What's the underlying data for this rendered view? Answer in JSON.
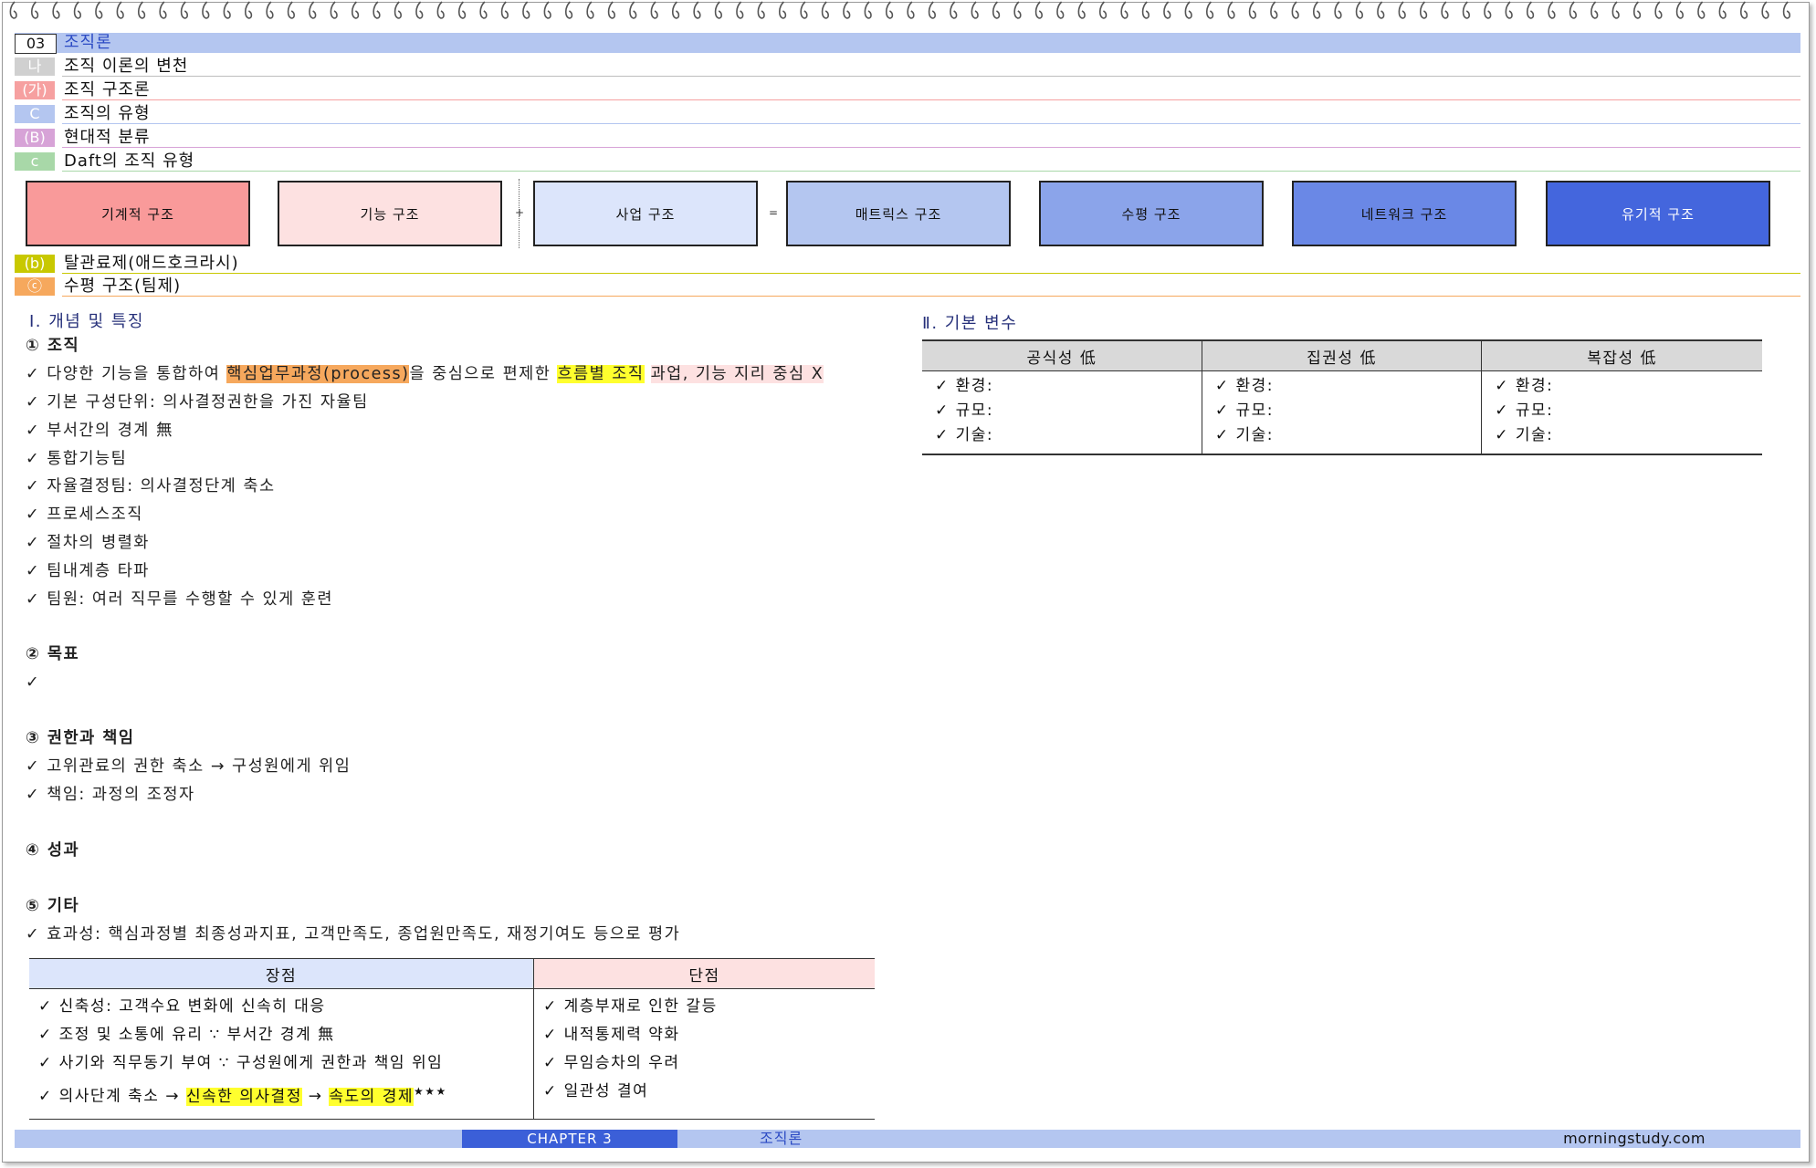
{
  "header_rows": [
    {
      "tag": "03",
      "text": "조직론",
      "tag_bg": "#ffffff",
      "tag_color": "#111111",
      "row_bg": "#b4c6f0",
      "text_color": "#2c4bc4",
      "rule": "#b4c6f0"
    },
    {
      "tag": "나",
      "text": "조직 이론의 변천",
      "tag_bg": "#d0d0d0",
      "tag_color": "#ffffff",
      "row_bg": "#ffffff",
      "text_color": "#111111",
      "rule": "#bdbdbd"
    },
    {
      "tag": "(가)",
      "text": "조직 구조론",
      "tag_bg": "#f6a0a0",
      "tag_color": "#ffffff",
      "row_bg": "#ffffff",
      "text_color": "#111111",
      "rule": "#f6a0a0"
    },
    {
      "tag": "C",
      "text": "조직의 유형",
      "tag_bg": "#b4c6f0",
      "tag_color": "#ffffff",
      "row_bg": "#ffffff",
      "text_color": "#111111",
      "rule": "#b4c6f0"
    },
    {
      "tag": "(B)",
      "text": "현대적 분류",
      "tag_bg": "#d7a3d7",
      "tag_color": "#ffffff",
      "row_bg": "#ffffff",
      "text_color": "#111111",
      "rule": "#d7a3d7"
    },
    {
      "tag": "c",
      "text": "Daft의 조직 유형",
      "tag_bg": "#a8d8a8",
      "tag_color": "#ffffff",
      "row_bg": "#ffffff",
      "text_color": "#111111",
      "rule": "#a8d8a8"
    }
  ],
  "org_boxes": [
    {
      "label": "기계적 구조",
      "bg": "#f99a9a"
    },
    {
      "label": "기능 구조",
      "bg": "#fde1e1"
    },
    {
      "label": "사업 구조",
      "bg": "#dce5fb"
    },
    {
      "label": "매트릭스 구조",
      "bg": "#b4c6f0"
    },
    {
      "label": "수평 구조",
      "bg": "#8ba4ea"
    },
    {
      "label": "네트워크 구조",
      "bg": "#6a88e6"
    },
    {
      "label": "유기적 구조",
      "bg": "#4466dd"
    }
  ],
  "ops": {
    "plus": "+",
    "equals": "="
  },
  "sub_rows": [
    {
      "tag": "(b)",
      "text": "탈관료제(애드호크라시)",
      "tag_bg": "#c8c800",
      "rule": "#c8c800"
    },
    {
      "tag": "ⓒ",
      "text": "수평 구조(팀제)",
      "tag_bg": "#f6a85d",
      "rule": "#f6a85d"
    }
  ],
  "section1": {
    "title": "Ⅰ. 개념 및 특징",
    "org_head": "① 조직",
    "org_items": [
      "✓ 기본 구성단위: 의사결정권한을 가진 자율팀",
      "✓ 부서간의 경계 無",
      "✓ 통합기능팀",
      "✓ 자율결정팀: 의사결정단계 축소",
      "✓ 프로세스조직",
      "✓ 절차의 병렬화",
      "✓ 팀내계층 타파",
      "✓ 팀원: 여러 직무를 수행할 수 있게 훈련"
    ],
    "first_item": {
      "a": "✓ 다양한 기능을 통합하여 ",
      "hl1": "핵심업무과정(process)",
      "b": "을 중심으로 편제한 ",
      "hl2": "흐름별 조직",
      "c": "  ",
      "hl3": "과업, 기능 지리 중심 X"
    },
    "goal_head": "② 목표",
    "goal_item": "✓",
    "auth_head": "③ 권한과 책임",
    "auth_items": [
      "✓ 고위관료의 권한 축소 → 구성원에게 위임",
      "✓ 책임: 과정의 조정자"
    ],
    "perf_head": "④ 성과",
    "etc_head": "⑤ 기타",
    "etc_item": "✓ 효과성: 핵심과정별 최종성과지표, 고객만족도, 종업원만족도, 재정기여도 등으로 평가"
  },
  "pros_cons": {
    "pro_head": "장점",
    "con_head": "단점",
    "pro_head_bg": "#dce5fb",
    "con_head_bg": "#fde1e1",
    "pros": [
      "✓ 신축성: 고객수요 변화에 신속히 대응",
      "✓ 조정 및 소통에 유리 ∵ 부서간 경계 無",
      "✓ 사기와 직무동기 부여 ∵ 구성원에게 권한과 책임 위임"
    ],
    "last_pro": {
      "a": "✓ 의사단계 축소 → ",
      "hl1": "신속한 의사결정",
      "b": "  → ",
      "hl2": "속도의 경제",
      "stars": "★★★"
    },
    "cons": [
      "✓ 계층부재로 인한 갈등",
      "✓ 내적통제력 약화",
      "✓ 무임승차의 우려",
      "✓ 일관성 결여"
    ]
  },
  "section2": {
    "title": "Ⅱ. 기본 변수",
    "cols": [
      {
        "head": "공식성 低",
        "items": [
          "✓ 환경:",
          "✓ 규모:",
          "✓ 기술:"
        ]
      },
      {
        "head": "집권성 低",
        "items": [
          "✓ 환경:",
          "✓ 규모:",
          "✓ 기술:"
        ]
      },
      {
        "head": "복잡성 低",
        "items": [
          "✓ 환경:",
          "✓ 규모:",
          "✓ 기술:"
        ]
      }
    ]
  },
  "footer": {
    "chapter": "CHAPTER 3",
    "name": "조직론",
    "site": "morningstudy.com"
  }
}
